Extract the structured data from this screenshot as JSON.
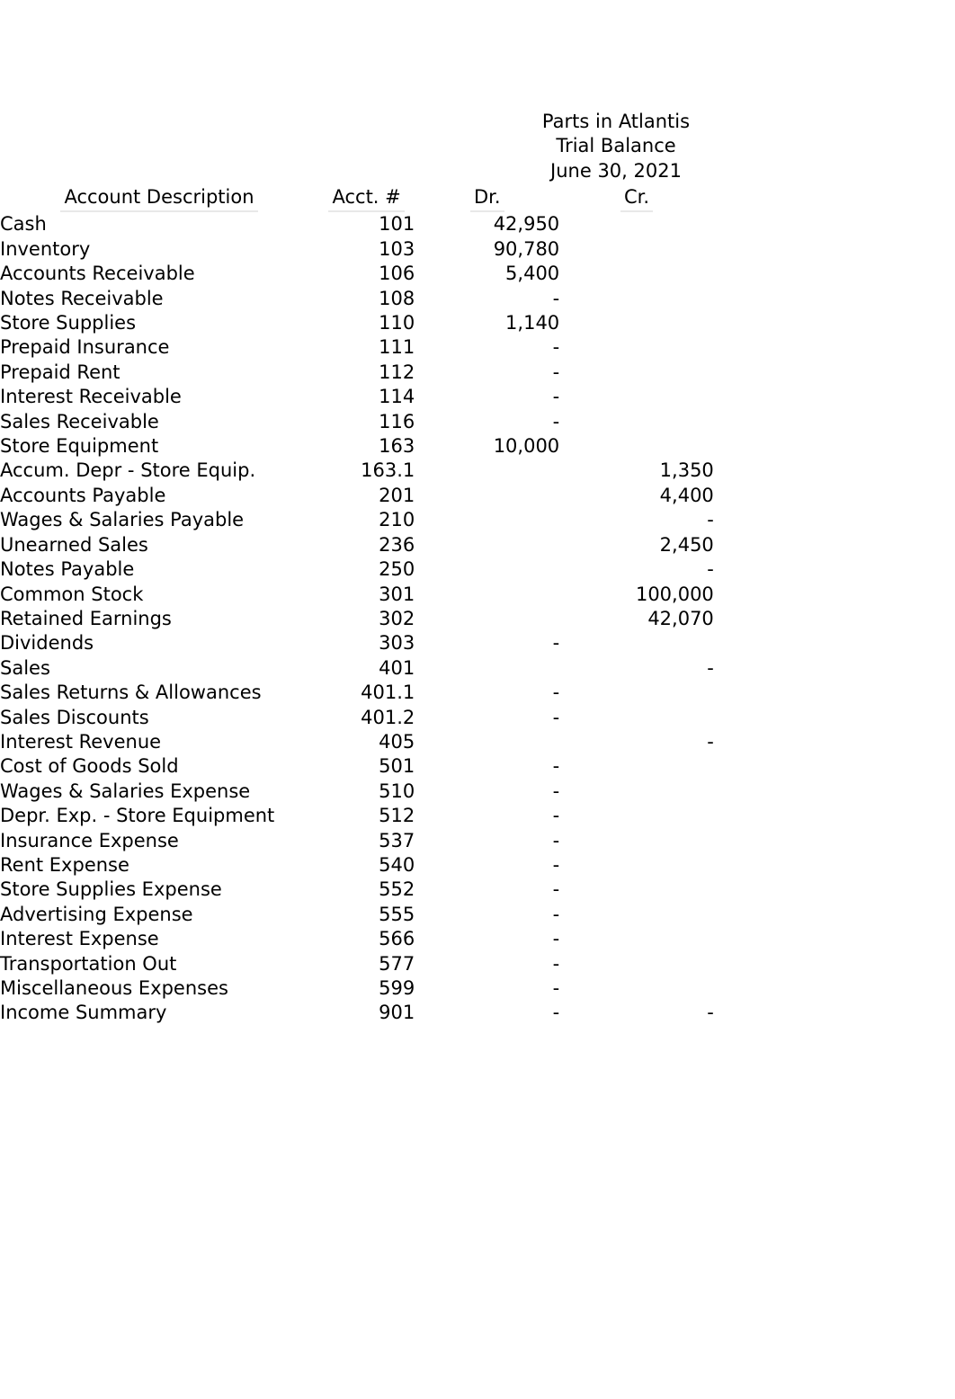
{
  "title": {
    "company": "Parts in Atlantis",
    "statement": "Trial Balance",
    "date": "June 30, 2021"
  },
  "columns": {
    "description": "Account Description",
    "account_number": "Acct. #",
    "debit": "Dr.",
    "credit": "Cr."
  },
  "zero_symbol": "-",
  "rows": [
    {
      "description": "Cash",
      "acct": "101",
      "dr": "42,950",
      "cr": ""
    },
    {
      "description": "Inventory",
      "acct": "103",
      "dr": "90,780",
      "cr": ""
    },
    {
      "description": "Accounts Receivable",
      "acct": "106",
      "dr": "5,400",
      "cr": ""
    },
    {
      "description": "Notes Receivable",
      "acct": "108",
      "dr": "-",
      "cr": ""
    },
    {
      "description": "Store Supplies",
      "acct": "110",
      "dr": "1,140",
      "cr": ""
    },
    {
      "description": "Prepaid Insurance",
      "acct": "111",
      "dr": "-",
      "cr": ""
    },
    {
      "description": "Prepaid Rent",
      "acct": "112",
      "dr": "-",
      "cr": ""
    },
    {
      "description": "Interest Receivable",
      "acct": "114",
      "dr": "-",
      "cr": ""
    },
    {
      "description": "Sales Receivable",
      "acct": "116",
      "dr": "-",
      "cr": ""
    },
    {
      "description": "Store Equipment",
      "acct": "163",
      "dr": "10,000",
      "cr": ""
    },
    {
      "description": "Accum. Depr - Store Equip.",
      "acct": "163.1",
      "dr": "",
      "cr": "1,350"
    },
    {
      "description": "Accounts Payable",
      "acct": "201",
      "dr": "",
      "cr": "4,400"
    },
    {
      "description": "Wages & Salaries Payable",
      "acct": "210",
      "dr": "",
      "cr": "-"
    },
    {
      "description": "Unearned Sales",
      "acct": "236",
      "dr": "",
      "cr": "2,450"
    },
    {
      "description": "Notes Payable",
      "acct": "250",
      "dr": "",
      "cr": "-"
    },
    {
      "description": "Common Stock",
      "acct": "301",
      "dr": "",
      "cr": "100,000"
    },
    {
      "description": "Retained Earnings",
      "acct": "302",
      "dr": "",
      "cr": "42,070"
    },
    {
      "description": "Dividends",
      "acct": "303",
      "dr": "-",
      "cr": ""
    },
    {
      "description": "Sales",
      "acct": "401",
      "dr": "",
      "cr": "-"
    },
    {
      "description": "Sales Returns & Allowances",
      "acct": "401.1",
      "dr": "-",
      "cr": ""
    },
    {
      "description": "Sales Discounts",
      "acct": "401.2",
      "dr": "-",
      "cr": ""
    },
    {
      "description": "Interest Revenue",
      "acct": "405",
      "dr": "",
      "cr": "-"
    },
    {
      "description": "Cost of Goods Sold",
      "acct": "501",
      "dr": "-",
      "cr": ""
    },
    {
      "description": "Wages & Salaries Expense",
      "acct": "510",
      "dr": "-",
      "cr": ""
    },
    {
      "description": "Depr. Exp. - Store Equipment",
      "acct": "512",
      "dr": "-",
      "cr": ""
    },
    {
      "description": "Insurance Expense",
      "acct": "537",
      "dr": "-",
      "cr": ""
    },
    {
      "description": "Rent Expense",
      "acct": "540",
      "dr": "-",
      "cr": ""
    },
    {
      "description": "Store Supplies Expense",
      "acct": "552",
      "dr": "-",
      "cr": ""
    },
    {
      "description": "Advertising Expense",
      "acct": "555",
      "dr": "-",
      "cr": ""
    },
    {
      "description": "Interest Expense",
      "acct": "566",
      "dr": "-",
      "cr": ""
    },
    {
      "description": "Transportation Out",
      "acct": "577",
      "dr": "-",
      "cr": ""
    },
    {
      "description": "Miscellaneous Expenses",
      "acct": "599",
      "dr": "-",
      "cr": ""
    },
    {
      "description": "Income Summary",
      "acct": "901",
      "dr": "-",
      "cr": "-"
    }
  ]
}
